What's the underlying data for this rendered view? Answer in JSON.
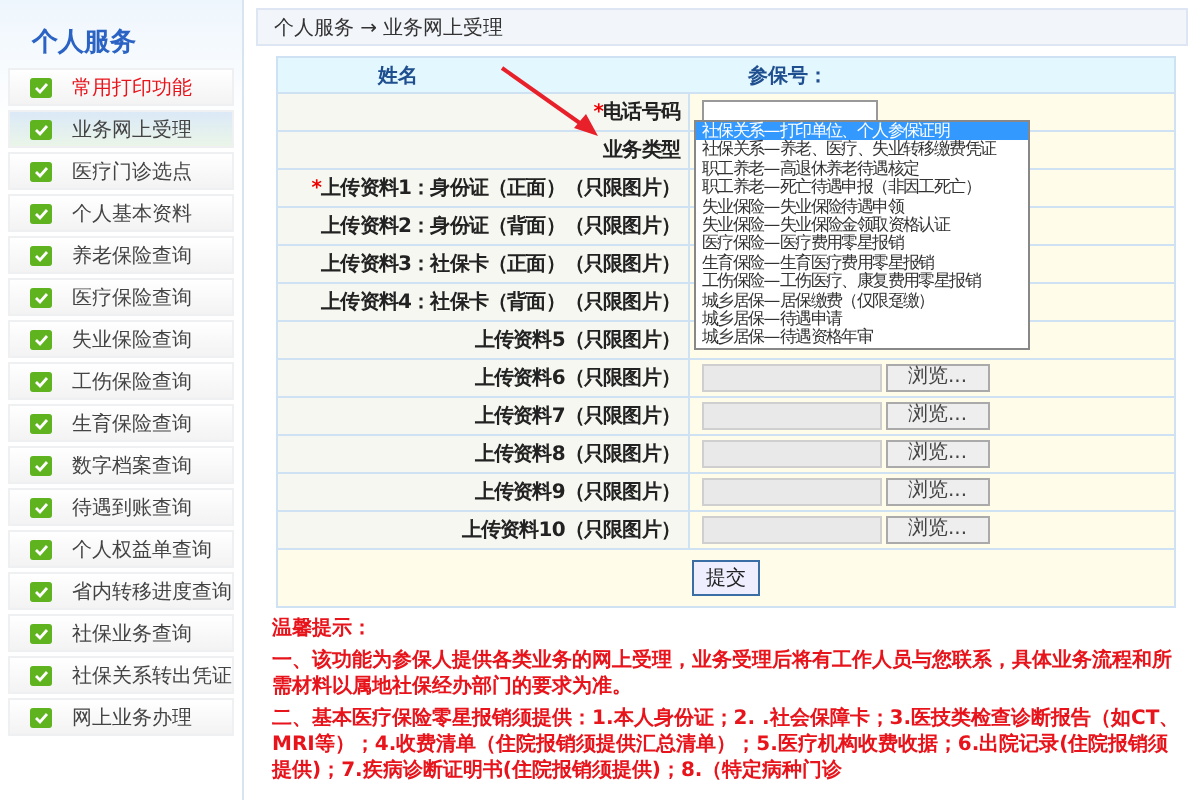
{
  "sidebar": {
    "title": "个人服务",
    "items": [
      {
        "label": "常用打印功能",
        "selected": false,
        "alert": true
      },
      {
        "label": "业务网上受理",
        "selected": true,
        "alert": false
      },
      {
        "label": "医疗门诊选点",
        "selected": false,
        "alert": false
      },
      {
        "label": "个人基本资料",
        "selected": false,
        "alert": false
      },
      {
        "label": "养老保险查询",
        "selected": false,
        "alert": false
      },
      {
        "label": "医疗保险查询",
        "selected": false,
        "alert": false
      },
      {
        "label": "失业保险查询",
        "selected": false,
        "alert": false
      },
      {
        "label": "工伤保险查询",
        "selected": false,
        "alert": false
      },
      {
        "label": "生育保险查询",
        "selected": false,
        "alert": false
      },
      {
        "label": "数字档案查询",
        "selected": false,
        "alert": false
      },
      {
        "label": "待遇到账查询",
        "selected": false,
        "alert": false
      },
      {
        "label": "个人权益单查询",
        "selected": false,
        "alert": false
      },
      {
        "label": "省内转移进度查询",
        "selected": false,
        "alert": false
      },
      {
        "label": "社保业务查询",
        "selected": false,
        "alert": false
      },
      {
        "label": "社保关系转出凭证",
        "selected": false,
        "alert": false
      },
      {
        "label": "网上业务办理",
        "selected": false,
        "alert": false
      }
    ]
  },
  "breadcrumb": "个人服务 → 业务网上受理",
  "form": {
    "header": {
      "name_label": "姓名",
      "id_label": "参保号："
    },
    "phone": {
      "label": "电话号码",
      "required_mark": "*"
    },
    "business_type": {
      "label": "业务类型",
      "options": [
        {
          "label": "社保关系—打印单位、个人参保证明",
          "selected": true
        },
        {
          "label": "社保关系—养老、医疗、失业转移缴费凭证",
          "selected": false
        },
        {
          "label": "职工养老—高退休养老待遇核定",
          "selected": false
        },
        {
          "label": "职工养老—死亡待遇申报（非因工死亡）",
          "selected": false
        },
        {
          "label": "失业保险—失业保险待遇申领",
          "selected": false
        },
        {
          "label": "失业保险—失业保险金领取资格认证",
          "selected": false
        },
        {
          "label": "医疗保险—医疗费用零星报销",
          "selected": false
        },
        {
          "label": "生育保险—生育医疗费用零星报销",
          "selected": false
        },
        {
          "label": "工伤保险—工伤医疗、康复费用零星报销",
          "selected": false
        },
        {
          "label": "城乡居保—居保缴费（仅限趸缴）",
          "selected": false
        },
        {
          "label": "城乡居保—待遇申请",
          "selected": false
        },
        {
          "label": "城乡居保—待遇资格年审",
          "selected": false
        }
      ]
    },
    "uploads": [
      {
        "label": "上传资料1：身份证（正面）（只限图片）",
        "required_mark": "*"
      },
      {
        "label": "上传资料2：身份证（背面）（只限图片）"
      },
      {
        "label": "上传资料3：社保卡（正面）（只限图片）"
      },
      {
        "label": "上传资料4：社保卡（背面）（只限图片）"
      },
      {
        "label": "上传资料5（只限图片）"
      },
      {
        "label": "上传资料6（只限图片）",
        "browse": "浏览..."
      },
      {
        "label": "上传资料7（只限图片）",
        "browse": "浏览..."
      },
      {
        "label": "上传资料8（只限图片）",
        "browse": "浏览..."
      },
      {
        "label": "上传资料9（只限图片）",
        "browse": "浏览..."
      },
      {
        "label": "上传资料10（只限图片）",
        "browse": "浏览..."
      }
    ],
    "submit": "提交"
  },
  "notes": {
    "title": "温馨提示：",
    "paragraphs": [
      "一、该功能为参保人提供各类业务的网上受理，业务受理后将有工作人员与您联系，具体业务流程和所需材料以属地社保经办部门的要求为准。",
      "二、基本医疗保险零星报销须提供：1.本人身份证；2. .社会保障卡；3.医技类检查诊断报告（如CT、MRI等）；4.收费清单（住院报销须提供汇总清单）；5.医疗机构收费收据；6.出院记录(住院报销须提供)；7.疾病诊断证明书(住院报销须提供)；8.（特定病种门诊"
    ]
  }
}
